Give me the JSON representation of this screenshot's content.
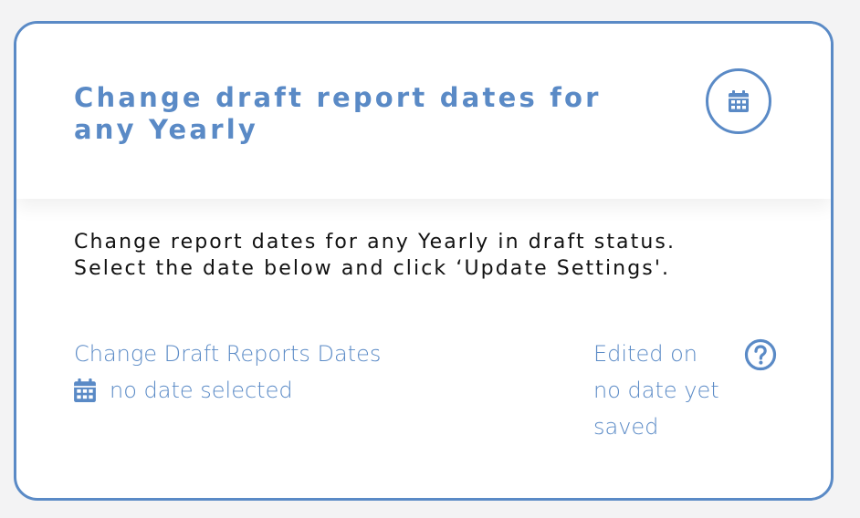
{
  "card": {
    "title": "Change draft report dates for any Yearly",
    "header_icon": "calendar-icon",
    "description_line1": "Change report dates for any Yearly in draft status.",
    "description_line2": "Select the date below and click ‘Update Settings'."
  },
  "field": {
    "label": "Change Draft Reports Dates",
    "icon": "calendar-icon",
    "value": "no date selected"
  },
  "edited": {
    "label": "Edited on",
    "value": "no date yet saved",
    "help_icon": "question-circle-icon"
  },
  "colors": {
    "accent": "#5a8ac6",
    "text": "#111111",
    "background": "#f3f3f4",
    "card": "#ffffff"
  }
}
